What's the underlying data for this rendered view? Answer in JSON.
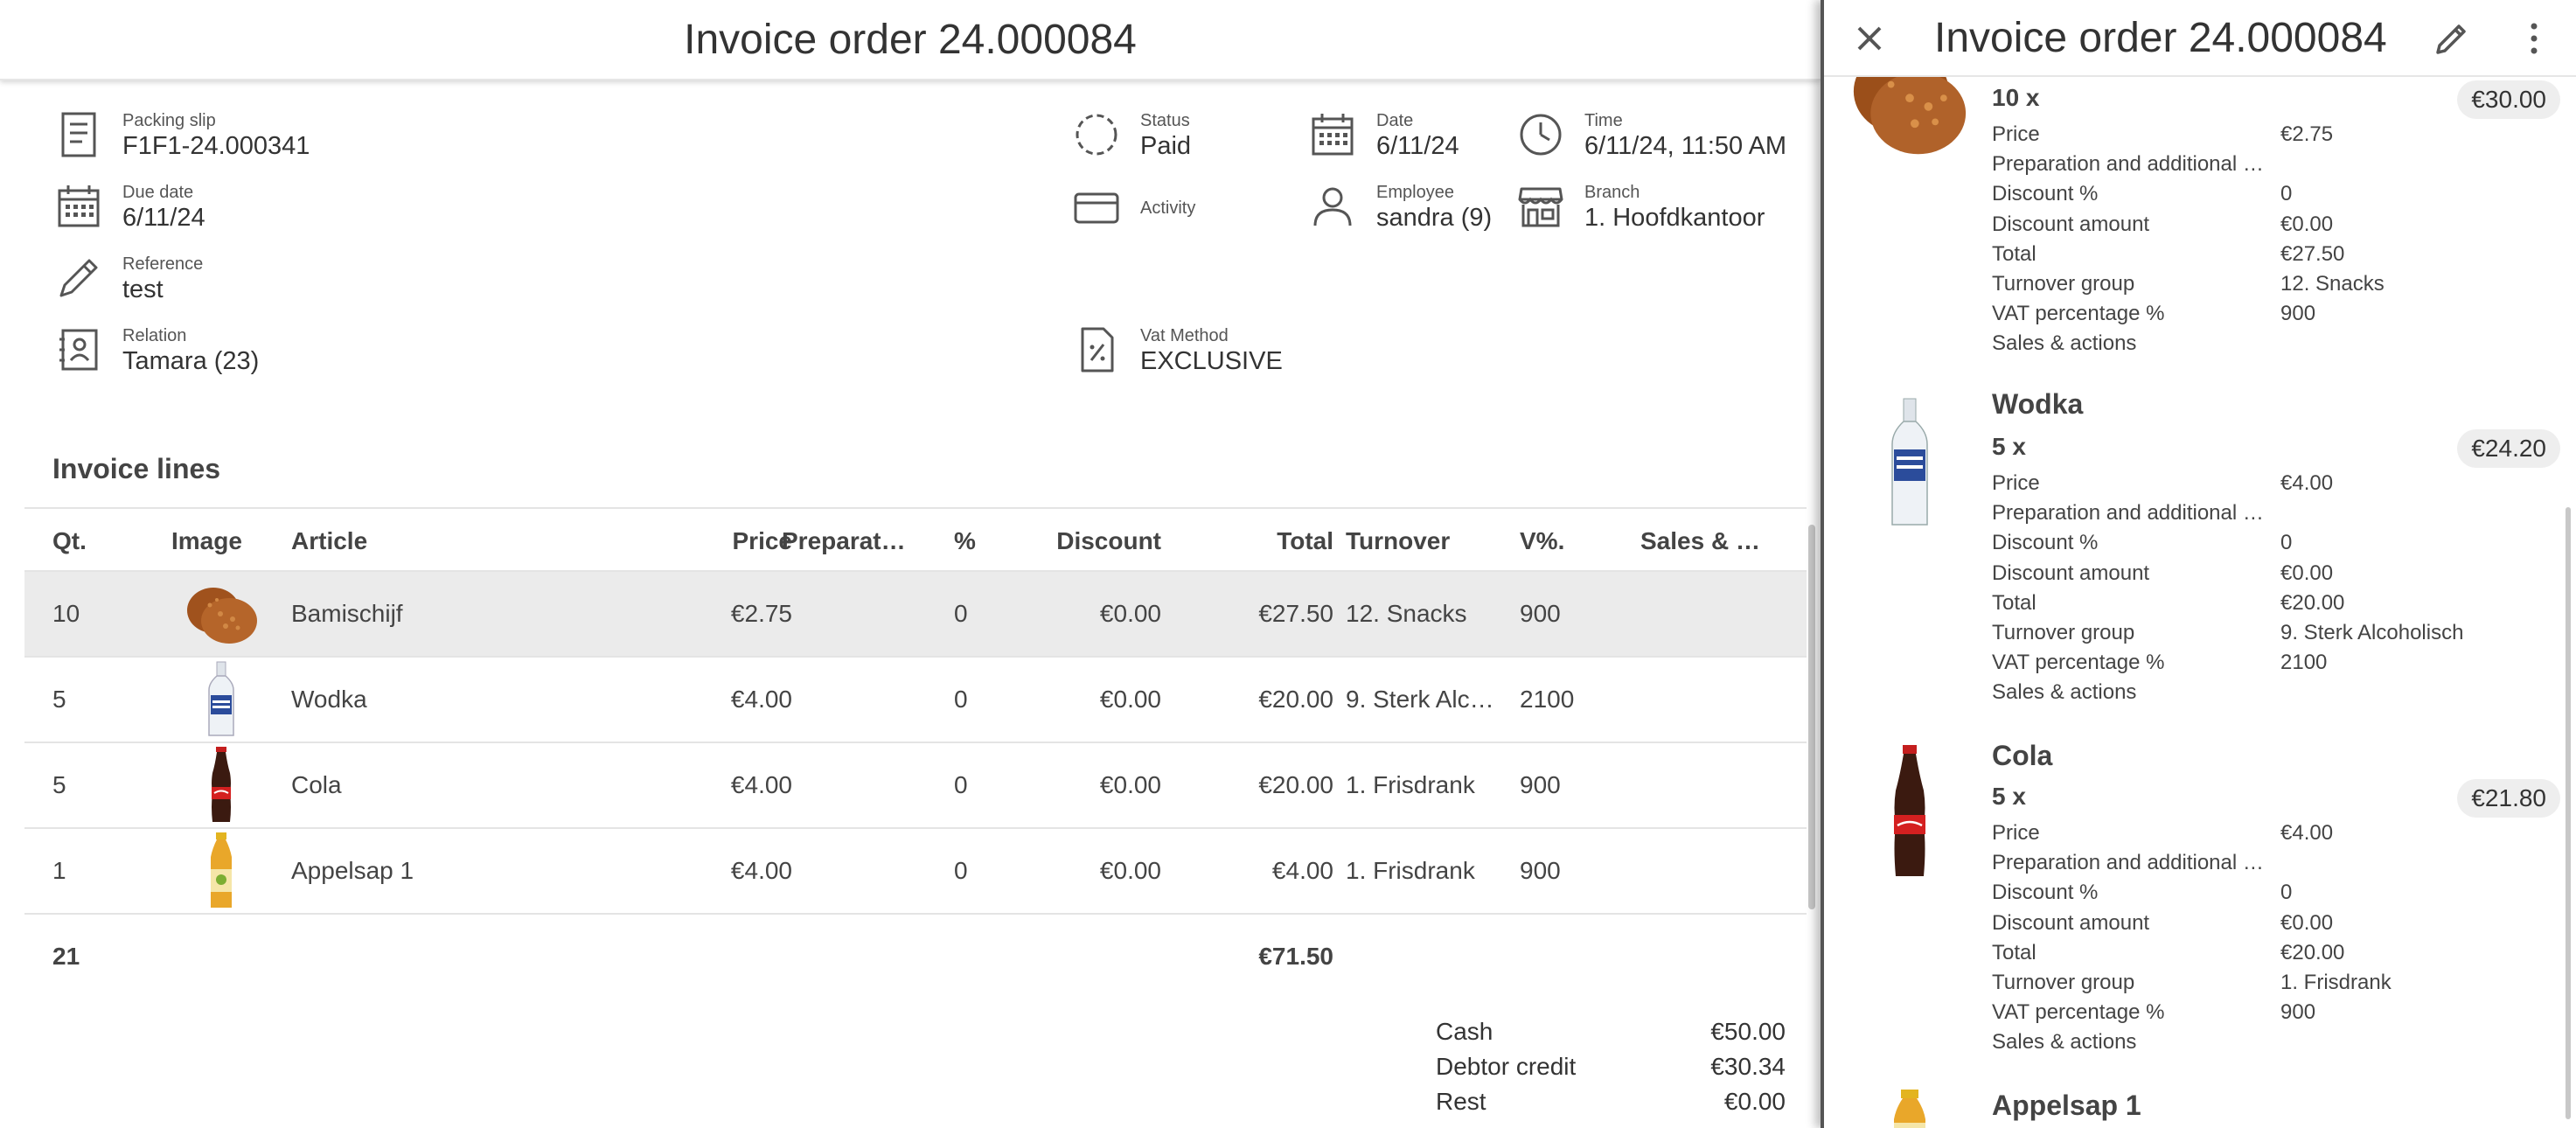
{
  "main": {
    "title": "Invoice order 24.000084",
    "info": {
      "packing_slip": {
        "label": "Packing slip",
        "value": "F1F1-24.000341"
      },
      "due_date": {
        "label": "Due date",
        "value": "6/11/24"
      },
      "reference": {
        "label": "Reference",
        "value": "test"
      },
      "relation": {
        "label": "Relation",
        "value": "Tamara (23)"
      },
      "status": {
        "label": "Status",
        "value": "Paid"
      },
      "activity": {
        "label": "Activity"
      },
      "vat_method": {
        "label": "Vat Method",
        "value": "EXCLUSIVE"
      },
      "date": {
        "label": "Date",
        "value": "6/11/24"
      },
      "employee": {
        "label": "Employee",
        "value": "sandra (9)"
      },
      "time": {
        "label": "Time",
        "value": "6/11/24, 11:50 AM"
      },
      "branch": {
        "label": "Branch",
        "value": "1. Hoofdkantoor"
      }
    },
    "section_title": "Invoice lines",
    "table": {
      "headers": {
        "qty": "Qt.",
        "image": "Image",
        "article": "Article",
        "price": "Price",
        "preparation": "Preparat…",
        "percent": "%",
        "discount": "Discount",
        "total": "Total",
        "turnover": "Turnover",
        "vat": "V%.",
        "sales": "Sales & …"
      },
      "rows": [
        {
          "qty": "10",
          "image": "bamischijf-image",
          "article": "Bamischijf",
          "price": "€2.75",
          "preparation": "",
          "percent": "0",
          "discount": "€0.00",
          "total": "€27.50",
          "turnover": "12. Snacks",
          "vat": "900",
          "sales": ""
        },
        {
          "qty": "5",
          "image": "wodka-image",
          "article": "Wodka",
          "price": "€4.00",
          "preparation": "",
          "percent": "0",
          "discount": "€0.00",
          "total": "€20.00",
          "turnover": "9. Sterk Alc…",
          "vat": "2100",
          "sales": ""
        },
        {
          "qty": "5",
          "image": "cola-image",
          "article": "Cola",
          "price": "€4.00",
          "preparation": "",
          "percent": "0",
          "discount": "€0.00",
          "total": "€20.00",
          "turnover": "1. Frisdrank",
          "vat": "900",
          "sales": ""
        },
        {
          "qty": "1",
          "image": "appelsap-image",
          "article": "Appelsap 1",
          "price": "€4.00",
          "preparation": "",
          "percent": "0",
          "discount": "€0.00",
          "total": "€4.00",
          "turnover": "1. Frisdrank",
          "vat": "900",
          "sales": ""
        }
      ],
      "footer": {
        "qty": "21",
        "total": "€71.50"
      }
    },
    "payments": [
      {
        "label": "Cash",
        "value": "€50.00"
      },
      {
        "label": "Debtor credit",
        "value": "€30.34"
      },
      {
        "label": "Rest",
        "value": "€0.00"
      }
    ]
  },
  "panel": {
    "title": "Invoice order 24.000084",
    "items": [
      {
        "name": "",
        "qty": "10 x",
        "total": "€30.00",
        "fields": [
          {
            "k": "Price",
            "v": "€2.75"
          },
          {
            "k": "Preparation and additional …",
            "v": ""
          },
          {
            "k": "Discount %",
            "v": "0"
          },
          {
            "k": "Discount amount",
            "v": "€0.00"
          },
          {
            "k": "Total",
            "v": "€27.50"
          },
          {
            "k": "Turnover group",
            "v": "12. Snacks"
          },
          {
            "k": "VAT percentage %",
            "v": "900"
          },
          {
            "k": "Sales & actions",
            "v": ""
          }
        ]
      },
      {
        "name": "Wodka",
        "qty": "5 x",
        "total": "€24.20",
        "fields": [
          {
            "k": "Price",
            "v": "€4.00"
          },
          {
            "k": "Preparation and additional …",
            "v": ""
          },
          {
            "k": "Discount %",
            "v": "0"
          },
          {
            "k": "Discount amount",
            "v": "€0.00"
          },
          {
            "k": "Total",
            "v": "€20.00"
          },
          {
            "k": "Turnover group",
            "v": "9. Sterk Alcoholisch"
          },
          {
            "k": "VAT percentage %",
            "v": "2100"
          },
          {
            "k": "Sales & actions",
            "v": ""
          }
        ]
      },
      {
        "name": "Cola",
        "qty": "5 x",
        "total": "€21.80",
        "fields": [
          {
            "k": "Price",
            "v": "€4.00"
          },
          {
            "k": "Preparation and additional …",
            "v": ""
          },
          {
            "k": "Discount %",
            "v": "0"
          },
          {
            "k": "Discount amount",
            "v": "€0.00"
          },
          {
            "k": "Total",
            "v": "€20.00"
          },
          {
            "k": "Turnover group",
            "v": "1. Frisdrank"
          },
          {
            "k": "VAT percentage %",
            "v": "900"
          },
          {
            "k": "Sales & actions",
            "v": ""
          }
        ]
      },
      {
        "name": "Appelsap 1",
        "qty": "",
        "total": "",
        "fields": []
      }
    ]
  }
}
